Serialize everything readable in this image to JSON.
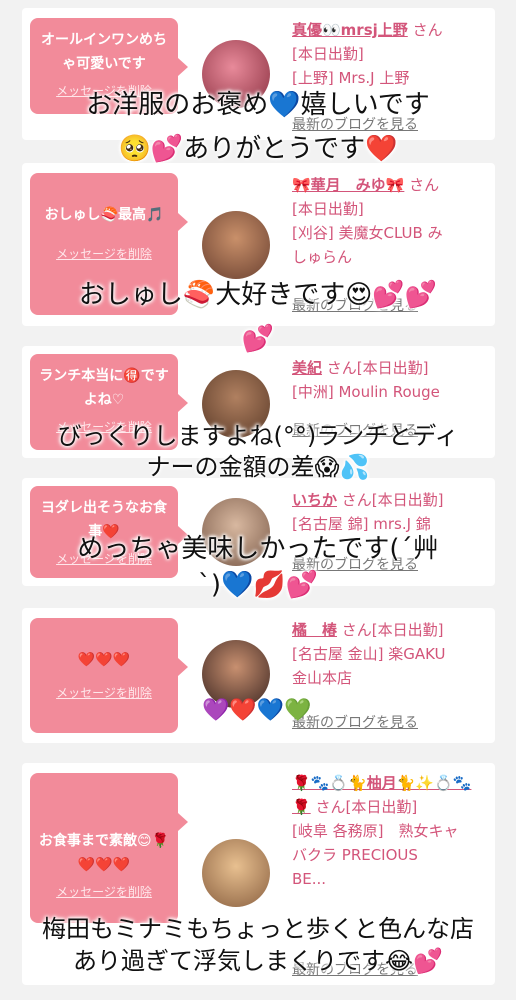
{
  "cards": [
    {
      "bubble": "オールインワンめちゃ可愛いです",
      "delete": "メッセージを削除",
      "name": "真優👀mrsj上野",
      "san": "さん",
      "lines": [
        "[本日出勤]",
        "[上野] Mrs.J 上野"
      ],
      "blog": "最新のブログを見る"
    },
    {
      "bubble": "おしゅし🍣最高🎵",
      "delete": "メッセージを削除",
      "name": "🎀華月　みゆ🎀",
      "san": "さん",
      "lines": [
        "[本日出勤]",
        "[刈谷] 美魔女CLUB み",
        "しゅらん"
      ],
      "blog": "最新のブログを見る"
    },
    {
      "bubble": "ランチ本当に🉐ですよね♡",
      "delete": "メッセージを削除",
      "name": "美紀",
      "san": "さん[本日出勤]",
      "lines": [
        "[中洲] Moulin Rouge"
      ],
      "blog": "最新のブログを見る"
    },
    {
      "bubble": "ヨダレ出そうなお食事❤️",
      "delete": "メッセージを削除",
      "name": "いちか",
      "san": "さん[本日出勤]",
      "lines": [
        "[名古屋 錦] mrs.J 錦"
      ],
      "blog": "最新のブログを見る"
    },
    {
      "bubble": "❤️❤️❤️",
      "delete": "メッセージを削除",
      "name": "橘　椿",
      "san": "さん[本日出勤]",
      "lines": [
        "[名古屋 金山] 楽GAKU",
        "金山本店"
      ],
      "blog": "最新のブログを見る"
    },
    {
      "bubble": "お食事まで素敵😊🌹❤️❤️❤️",
      "delete": "メッセージを削除",
      "name": "🌹🐾💍🐈柚月🐈✨💍🐾🌹",
      "san": "さん[本日出勤]",
      "lines": [
        "[岐阜 各務原]　熟女キャ",
        "バクラ PRECIOUS",
        "BE..."
      ],
      "blog": "最新のブログを見る"
    }
  ],
  "overlays": [
    "お洋服のお褒め💙嬉しいです",
    "🥺💕ありがとうです❤️",
    "おしゅし🍣大好きです😍💕💕",
    "💕",
    "びっくりしますよね(°°)ランチとディ",
    "ナーの金額の差😱💦",
    "めっちゃ美味しかったです(´艸",
    "`)💙💋💕",
    "梅田もミナミもちょっと歩くと色んな店",
    "あり過ぎて浮気しまくりです😂💕"
  ],
  "hearts": "💜❤️💙💚"
}
